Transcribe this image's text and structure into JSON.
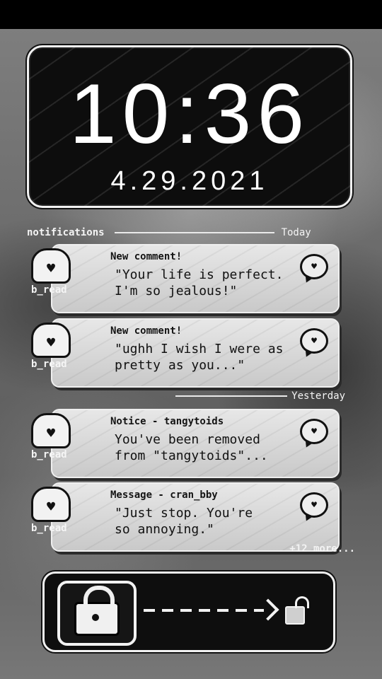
{
  "lockscreen": {
    "time": "10:36",
    "date": "4.29.2021"
  },
  "sections": {
    "header_label": "notifications",
    "today": "Today",
    "yesterday": "Yesterday"
  },
  "notifications": [
    {
      "user": "b_read",
      "title": "New comment!",
      "body": "\"Your life is perfect.\nI'm so jealous!\"",
      "icon": "speech-bubble-heart-icon"
    },
    {
      "user": "b_read",
      "title": "New comment!",
      "body": "\"ughh I wish I were as\npretty as you...\"",
      "icon": "speech-bubble-heart-icon"
    },
    {
      "user": "b_read",
      "title": "Notice - tangytoids",
      "body": "You've been removed\nfrom \"tangytoids\"...",
      "icon": "speech-bubble-heart-icon"
    },
    {
      "user": "b_read",
      "title": "Message - cran_bby",
      "body": "\"Just stop. You're\nso annoying.\"",
      "icon": "speech-bubble-heart-icon"
    }
  ],
  "more_label": "+12 more...",
  "unlock": {
    "lock_icon": "lock-icon",
    "unlocked_icon": "unlocked-lock-icon"
  }
}
